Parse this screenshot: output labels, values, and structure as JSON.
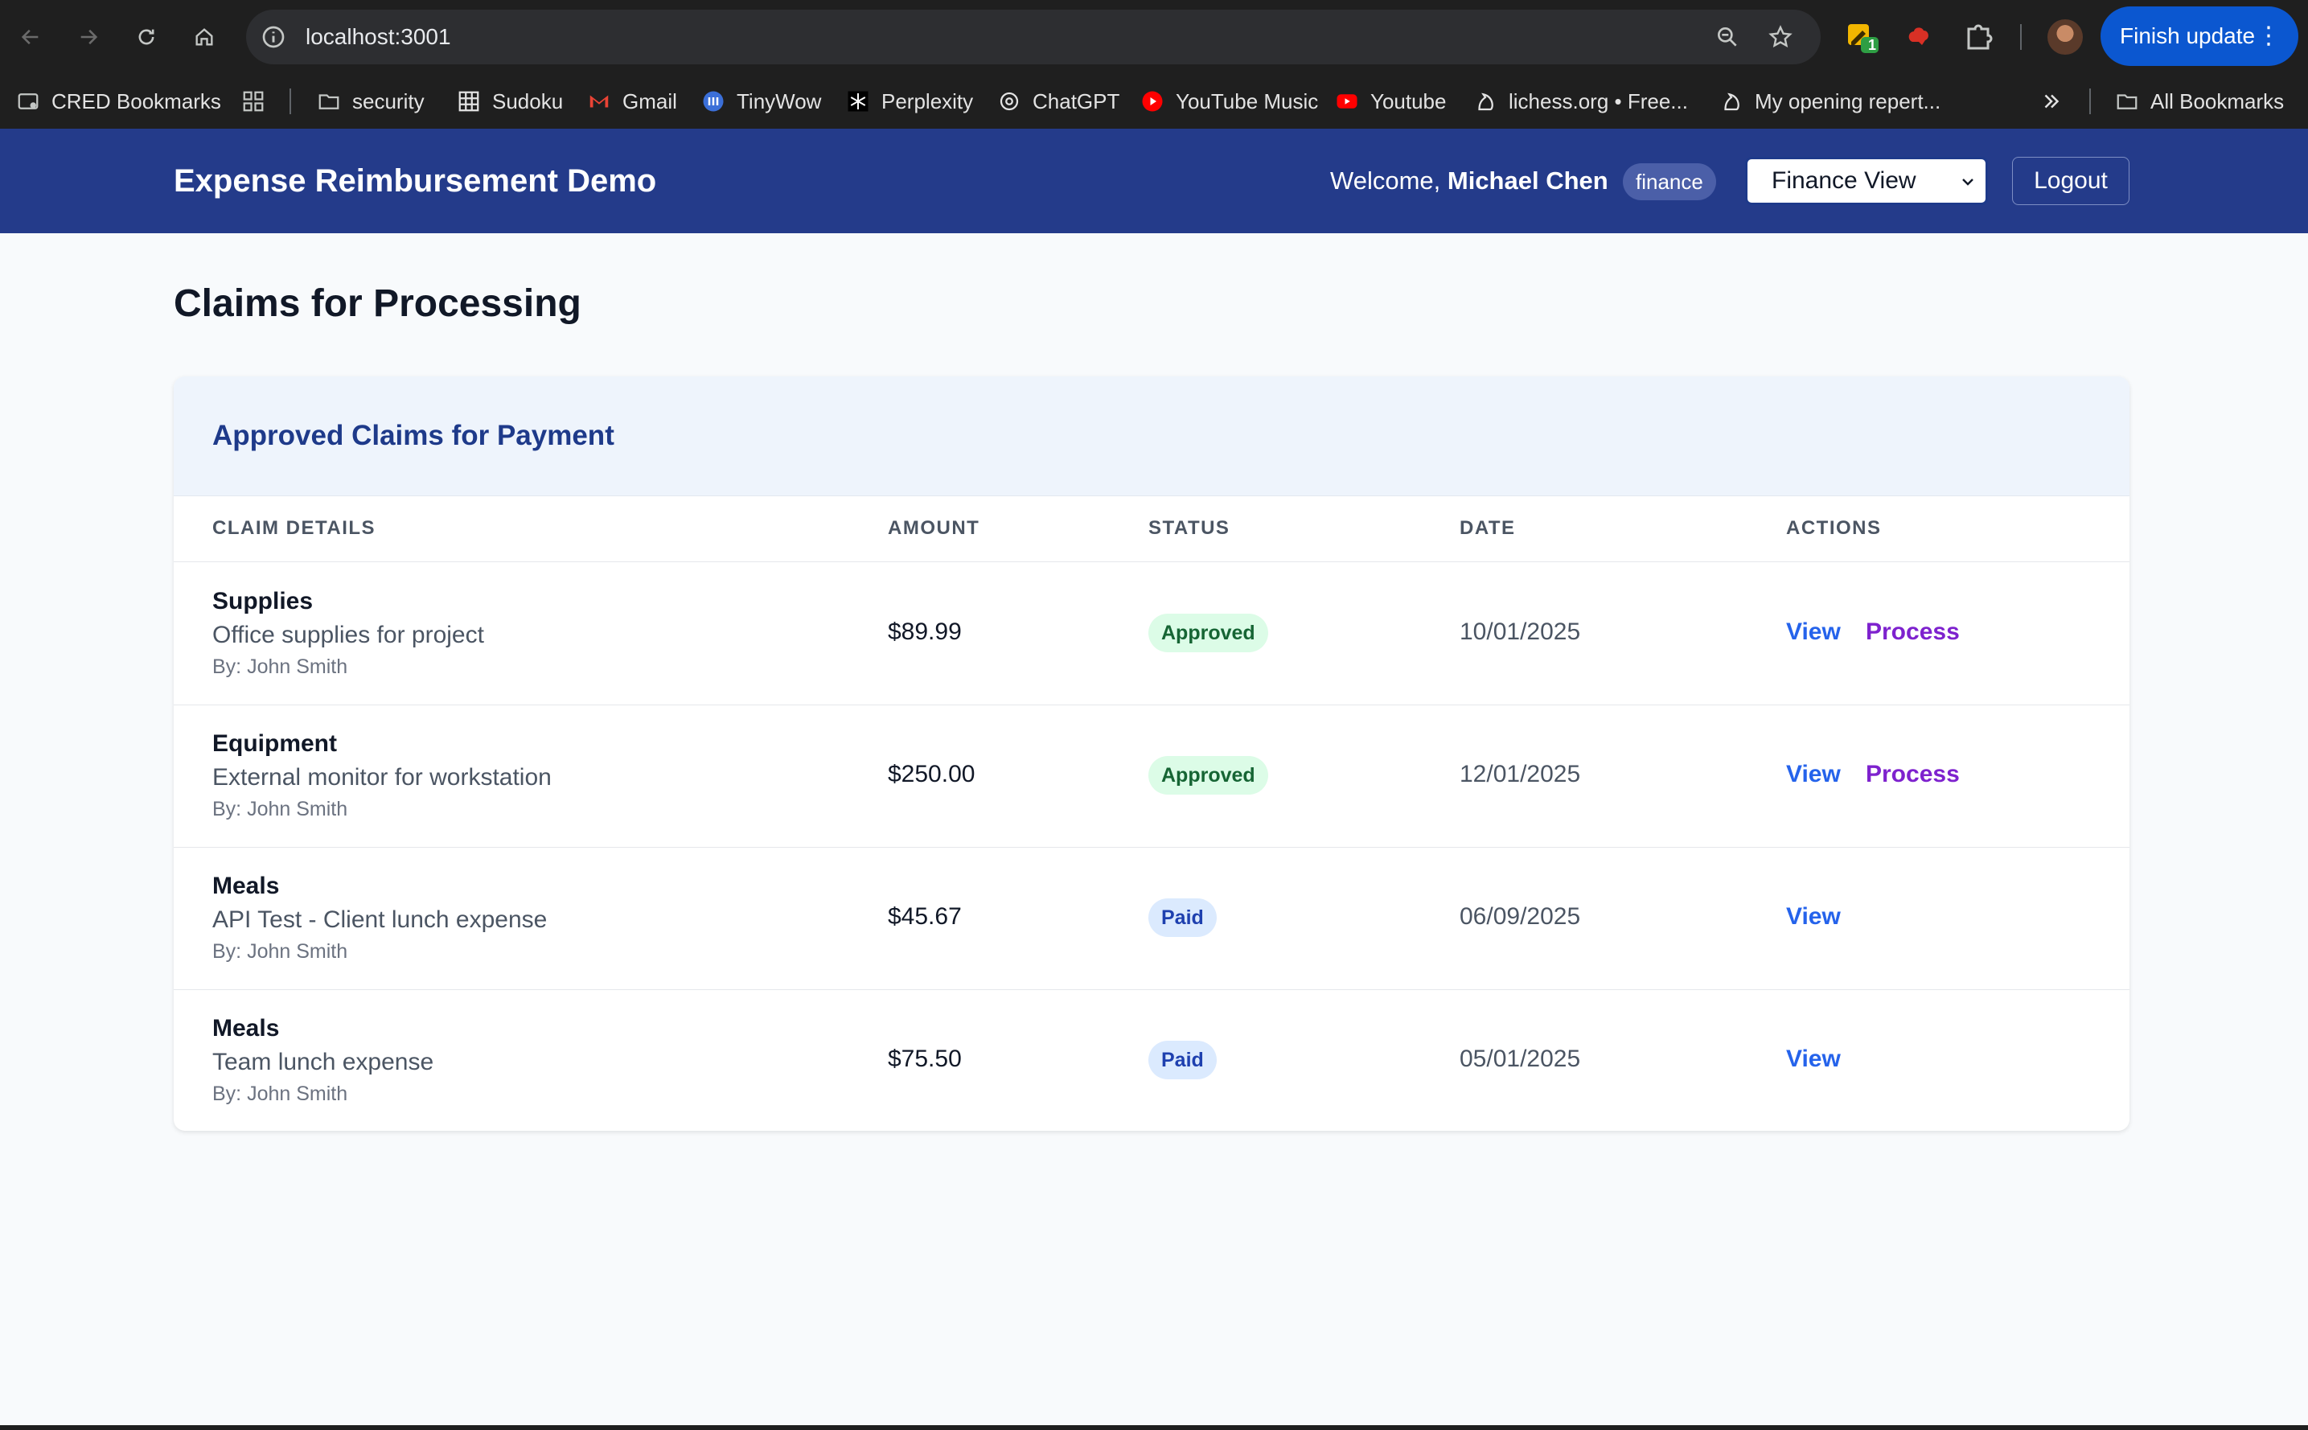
{
  "browser": {
    "url": "localhost:3001",
    "finish_update_label": "Finish update",
    "extension_badge": "1",
    "bookmarks": [
      {
        "label": "CRED Bookmarks",
        "icon": "bookmark-manager-icon"
      },
      {
        "label": "",
        "icon": "apps-grid-icon"
      },
      {
        "label": "security",
        "icon": "folder-icon"
      },
      {
        "label": "Sudoku",
        "icon": "sudoku-icon"
      },
      {
        "label": "Gmail",
        "icon": "gmail-icon"
      },
      {
        "label": "TinyWow",
        "icon": "tinywow-icon"
      },
      {
        "label": "Perplexity",
        "icon": "perplexity-icon"
      },
      {
        "label": "ChatGPT",
        "icon": "chatgpt-icon"
      },
      {
        "label": "YouTube Music",
        "icon": "youtube-music-icon"
      },
      {
        "label": "Youtube",
        "icon": "youtube-icon"
      },
      {
        "label": "lichess.org • Free...",
        "icon": "lichess-icon"
      },
      {
        "label": "My opening repert...",
        "icon": "lichess-icon"
      }
    ],
    "all_bookmarks_label": "All Bookmarks"
  },
  "header": {
    "brand": "Expense Reimbursement Demo",
    "welcome_prefix": "Welcome,",
    "user_name": "Michael Chen",
    "role": "finance",
    "view_selected": "Finance View",
    "logout_label": "Logout",
    "brand_color": "#243b8a"
  },
  "main": {
    "page_title": "Claims for Processing",
    "card_title": "Approved Claims for Payment",
    "columns": [
      "CLAIM DETAILS",
      "AMOUNT",
      "STATUS",
      "DATE",
      "ACTIONS"
    ],
    "claims": [
      {
        "category": "Supplies",
        "description": "Office supplies for project",
        "by": "By: John Smith",
        "amount": "$89.99",
        "status": "Approved",
        "date": "10/01/2025",
        "view_label": "View",
        "process_label": "Process"
      },
      {
        "category": "Equipment",
        "description": "External monitor for workstation",
        "by": "By: John Smith",
        "amount": "$250.00",
        "status": "Approved",
        "date": "12/01/2025",
        "view_label": "View",
        "process_label": "Process"
      },
      {
        "category": "Meals",
        "description": "API Test - Client lunch expense",
        "by": "By: John Smith",
        "amount": "$45.67",
        "status": "Paid",
        "date": "06/09/2025",
        "view_label": "View",
        "process_label": null
      },
      {
        "category": "Meals",
        "description": "Team lunch expense",
        "by": "By: John Smith",
        "amount": "$75.50",
        "status": "Paid",
        "date": "05/01/2025",
        "view_label": "View",
        "process_label": null
      }
    ],
    "status_colors": {
      "approved_bg": "#dcfce7",
      "approved_text": "#166534",
      "paid_bg": "#dbeafe",
      "paid_text": "#1e40af"
    }
  }
}
